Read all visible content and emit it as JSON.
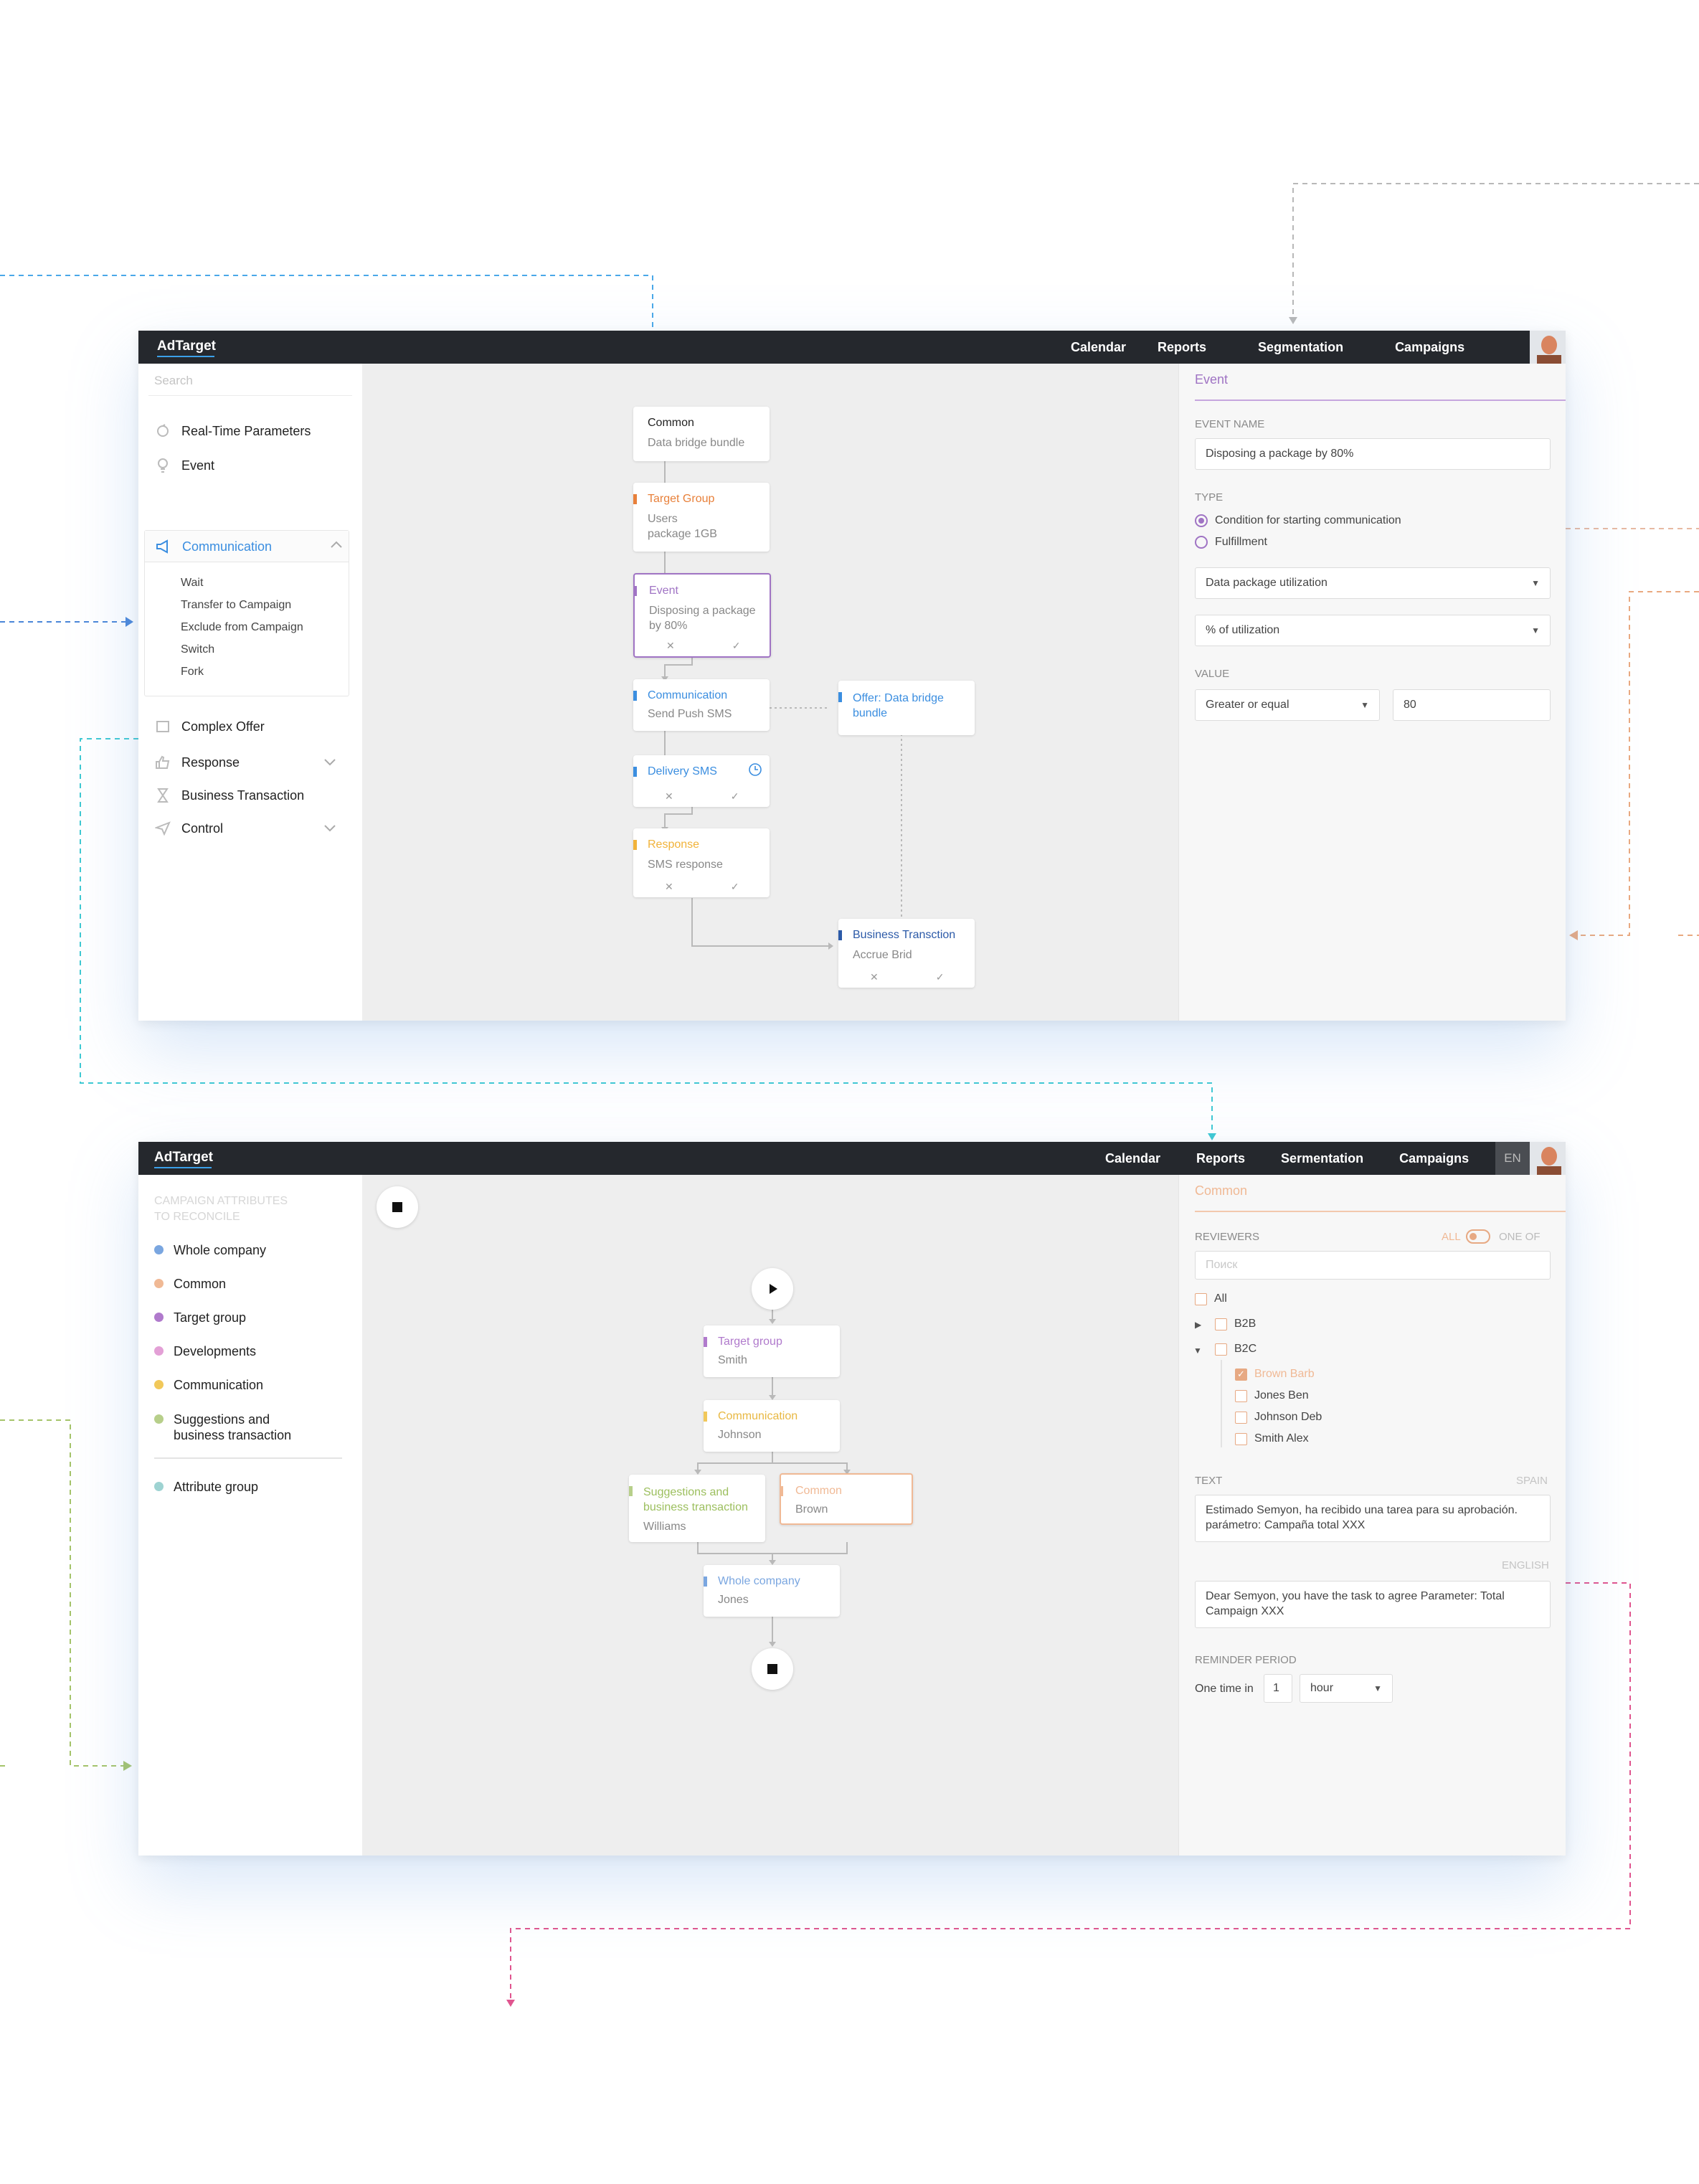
{
  "screen1": {
    "app": {
      "logo": "AdTarget"
    },
    "nav": [
      "Calendar",
      "Reports",
      "Segmentation",
      "Campaigns"
    ],
    "sidebar": {
      "search_placeholder": "Search",
      "items": [
        {
          "label": "Real-Time Parameters",
          "icon": "refresh-icon"
        },
        {
          "label": "Event",
          "icon": "lightbulb-icon"
        }
      ],
      "communication": {
        "label": "Communication",
        "icon": "megaphone-icon",
        "children": [
          "Wait",
          "Transfer to Campaign",
          "Exclude from Campaign",
          "Switch",
          "Fork"
        ]
      },
      "items_after": [
        {
          "label": "Complex Offer",
          "icon": "offer-icon"
        },
        {
          "label": "Response",
          "icon": "thumbs-up-icon"
        },
        {
          "label": "Business Transaction",
          "icon": "hourglass-icon"
        },
        {
          "label": "Control",
          "icon": "send-icon"
        }
      ]
    },
    "flow": {
      "common": {
        "title": "Common",
        "sub": "Data bridge bundle"
      },
      "target_group": {
        "title": "Target Group",
        "sub1": "Users",
        "sub2": "package 1GB"
      },
      "event": {
        "title": "Event",
        "sub1": "Disposing a package",
        "sub2": "by 80%"
      },
      "communication": {
        "title": "Communication",
        "sub": "Send Push SMS"
      },
      "offer": {
        "title1": "Offer: Data bridge",
        "title2": "bundle"
      },
      "delivery": {
        "title": "Delivery SMS"
      },
      "response": {
        "title": "Response",
        "sub": "SMS response"
      },
      "business": {
        "title": "Business Transction",
        "sub": "Accrue Brid"
      }
    },
    "panel": {
      "title": "Event",
      "event_name_label": "EVENT NAME",
      "event_name_value": "Disposing a package by 80%",
      "type_label": "TYPE",
      "type_options": [
        "Condition for starting communication",
        "Fulfillment"
      ],
      "type_selected": 0,
      "select1": "Data package utilization",
      "select2": "% of utilization",
      "value_label": "VALUE",
      "operator": "Greater or equal",
      "value": "80"
    }
  },
  "screen2": {
    "app": {
      "logo": "AdTarget"
    },
    "nav": [
      "Calendar",
      "Reports",
      "Sermentation",
      "Campaigns"
    ],
    "lang": "EN",
    "sidebar": {
      "header1": "CAMPAIGN ATTRIBUTES",
      "header2": "TO RECONCILE",
      "items": [
        {
          "label": "Whole company",
          "color": "#7aa6e0"
        },
        {
          "label": "Common",
          "color": "#f0b995"
        },
        {
          "label": "Target group",
          "color": "#b07acc"
        },
        {
          "label": "Developments",
          "color": "#e3a0d6"
        },
        {
          "label": "Communication",
          "color": "#f1c85a"
        },
        {
          "label": "Suggestions and",
          "label2": "business transaction",
          "color": "#b7cf8a"
        }
      ],
      "attribute_group": {
        "label": "Attribute group",
        "color": "#9ed3d2"
      }
    },
    "flow": {
      "target_group": {
        "title": "Target group",
        "sub": "Smith"
      },
      "communication": {
        "title": "Communication",
        "sub": "Johnson"
      },
      "suggestions": {
        "title1": "Suggestions and",
        "title2": "business transaction",
        "sub": "Williams"
      },
      "common": {
        "title": "Common",
        "sub": "Brown"
      },
      "whole": {
        "title": "Whole company",
        "sub": "Jones"
      }
    },
    "panel": {
      "title": "Common",
      "reviewers_label": "REVIEWERS",
      "toggle_all": "ALL",
      "toggle_one": "ONE OF",
      "search_placeholder": "Поиск",
      "tree": {
        "all": "All",
        "b2b": "B2B",
        "b2c": "B2C",
        "members": [
          {
            "label": "Brown Barb",
            "checked": true
          },
          {
            "label": "Jones Ben",
            "checked": false
          },
          {
            "label": "Johnson Deb",
            "checked": false
          },
          {
            "label": "Smith Alex",
            "checked": false
          }
        ]
      },
      "text_label": "TEXT",
      "lang_spain": "SPAIN",
      "text_es1": "Estimado Semyon, ha recibido una tarea para su aprobación.",
      "text_es2": "parámetro: Campaña total XXX",
      "lang_english": "ENGLISH",
      "text_en1": "Dear Semyon, you have the task to agree Parameter: Total",
      "text_en2": "Campaign XXX",
      "reminder_label": "REMINDER PERIOD",
      "reminder_prefix": "One time in",
      "reminder_value": "1",
      "reminder_unit": "hour"
    }
  },
  "colors": {
    "topbar": "#25282d",
    "accent_purple": "#a074c4",
    "accent_blue": "#3ba0e8",
    "accent_peach": "#e7a983",
    "target_orange": "#e8803a"
  }
}
